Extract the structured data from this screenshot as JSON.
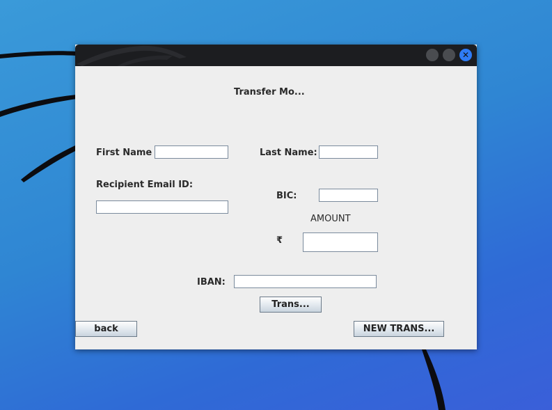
{
  "window": {
    "close_glyph": "✕"
  },
  "form": {
    "heading": "Transfer Mo...",
    "first_name_label": "First Name",
    "first_name_value": "",
    "last_name_label": "Last Name:",
    "last_name_value": "",
    "email_label": "Recipient Email ID:",
    "email_value": "",
    "bic_label": "BIC:",
    "bic_value": "",
    "amount_label": "AMOUNT",
    "currency_symbol": "₹",
    "amount_value": "",
    "iban_label": "IBAN:",
    "iban_value": ""
  },
  "buttons": {
    "transfer_label": "Trans...",
    "back_label": "back",
    "new_transfer_label": "NEW TRANS..."
  },
  "colors": {
    "titlebar": "#1c1d20",
    "window_bg": "#eeeeee",
    "close_button": "#2f7cf6",
    "desktop": "#2f86d3"
  }
}
